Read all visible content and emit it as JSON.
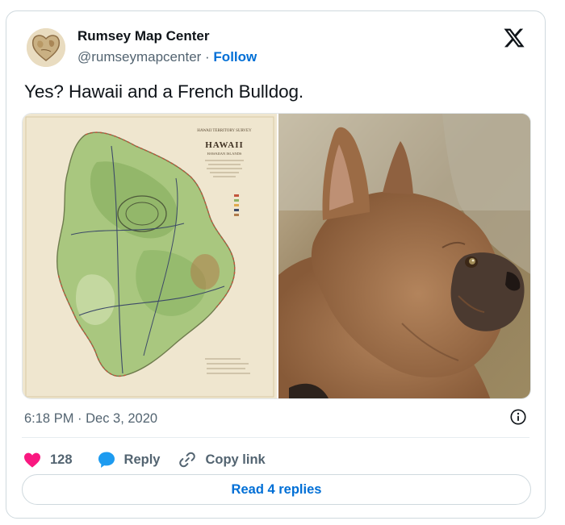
{
  "author": {
    "display_name": "Rumsey Map Center",
    "handle": "@rumseymapcenter",
    "separator": " · ",
    "follow_label": "Follow"
  },
  "tweet": {
    "text": "Yes? Hawaii and a French Bulldog.",
    "timestamp": "6:18 PM · Dec 3, 2020"
  },
  "media": {
    "map_title": "HAWAII",
    "map_header": "HAWAII TERRITORY SURVEY",
    "map_subtitle": "HAWAIIAN ISLANDS"
  },
  "actions": {
    "like_count": "128",
    "reply_label": "Reply",
    "copy_link_label": "Copy link"
  },
  "read_replies_label": "Read 4 replies",
  "colors": {
    "link_blue": "#006fd6",
    "like_pink": "#f91880",
    "reply_blue": "#1d9bf0",
    "muted": "#536471",
    "border": "#cfd9de"
  },
  "icons": [
    "x-logo-icon",
    "info-icon",
    "heart-icon",
    "speech-bubble-icon",
    "link-icon"
  ]
}
